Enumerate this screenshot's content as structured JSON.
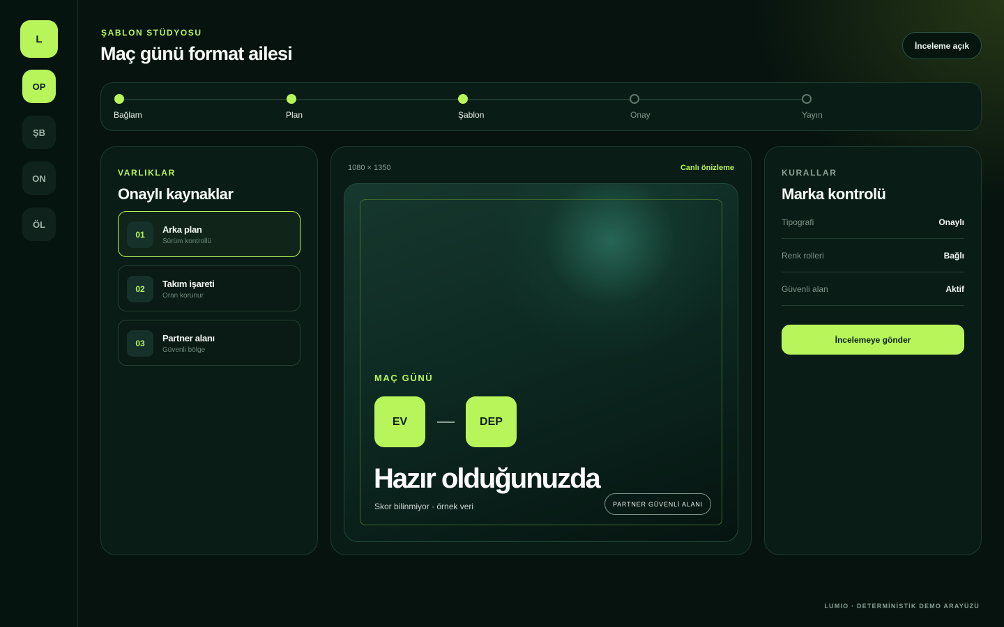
{
  "sidebar": {
    "logo": "L",
    "items": [
      {
        "label": "OP",
        "active": true
      },
      {
        "label": "ŞB",
        "active": false
      },
      {
        "label": "ON",
        "active": false
      },
      {
        "label": "ÖL",
        "active": false
      }
    ]
  },
  "header": {
    "eyebrow": "ŞABLON STÜDYOSU",
    "title": "Maç günü format ailesi",
    "status_pill": "İnceleme açık"
  },
  "stepper": {
    "steps": [
      {
        "label": "Bağlam",
        "done": true
      },
      {
        "label": "Plan",
        "done": true
      },
      {
        "label": "Şablon",
        "done": true
      },
      {
        "label": "Onay",
        "done": false
      },
      {
        "label": "Yayın",
        "done": false
      }
    ]
  },
  "assets": {
    "eyebrow": "VARLIKLAR",
    "title": "Onaylı kaynaklar",
    "items": [
      {
        "num": "01",
        "name": "Arka plan",
        "sub": "Sürüm kontrollü",
        "selected": true
      },
      {
        "num": "02",
        "name": "Takım işareti",
        "sub": "Oran korunur",
        "selected": false
      },
      {
        "num": "03",
        "name": "Partner alanı",
        "sub": "Güvenli bölge",
        "selected": false
      }
    ]
  },
  "preview": {
    "dimensions": "1080 × 1350",
    "live_label": "Canlı önizleme",
    "match_eyebrow": "MAÇ GÜNÜ",
    "home_team": "EV",
    "away_team": "DEP",
    "headline": "Hazır olduğunuzda",
    "score_note": "Skor bilinmiyor · örnek veri",
    "safe_area_pill": "PARTNER GÜVENLİ ALANI"
  },
  "rules": {
    "eyebrow": "KURALLAR",
    "title": "Marka kontrolü",
    "items": [
      {
        "label": "Tipografi",
        "value": "Onaylı"
      },
      {
        "label": "Renk rolleri",
        "value": "Bağlı"
      },
      {
        "label": "Güvenli alan",
        "value": "Aktif"
      }
    ],
    "submit_label": "İncelemeye gönder"
  },
  "footer": "LUMIO · DETERMİNİSTİK DEMO ARAYÜZÜ",
  "colors": {
    "accent": "#b8f55a",
    "background": "#06130f",
    "panel": "#0a1c16",
    "border": "#1f3b2f"
  }
}
